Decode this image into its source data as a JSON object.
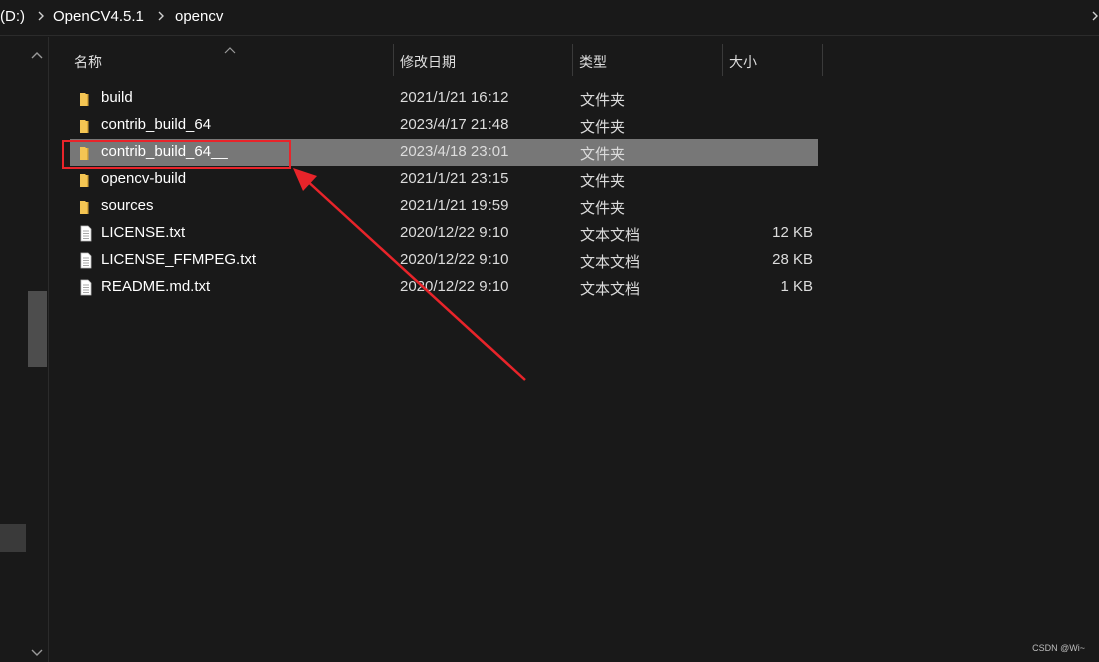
{
  "breadcrumb": {
    "drive": "(D:)",
    "folder1": "OpenCV4.5.1",
    "folder2": "opencv"
  },
  "columns": {
    "name": "名称",
    "date": "修改日期",
    "type": "类型",
    "size": "大小"
  },
  "files": [
    {
      "name": "build",
      "date": "2021/1/21 16:12",
      "type": "文件夹",
      "size": "",
      "icon": "folder-icon"
    },
    {
      "name": "contrib_build_64",
      "date": "2023/4/17 21:48",
      "type": "文件夹",
      "size": "",
      "icon": "folder-icon"
    },
    {
      "name": "contrib_build_64__",
      "date": "2023/4/18 23:01",
      "type": "文件夹",
      "size": "",
      "icon": "folder-icon",
      "selected": true
    },
    {
      "name": "opencv-build",
      "date": "2021/1/21 23:15",
      "type": "文件夹",
      "size": "",
      "icon": "folder-icon"
    },
    {
      "name": "sources",
      "date": "2021/1/21 19:59",
      "type": "文件夹",
      "size": "",
      "icon": "folder-icon"
    },
    {
      "name": "LICENSE.txt",
      "date": "2020/12/22 9:10",
      "type": "文本文档",
      "size": "12 KB",
      "icon": "text-file-icon"
    },
    {
      "name": "LICENSE_FFMPEG.txt",
      "date": "2020/12/22 9:10",
      "type": "文本文档",
      "size": "28 KB",
      "icon": "text-file-icon"
    },
    {
      "name": "README.md.txt",
      "date": "2020/12/22 9:10",
      "type": "文本文档",
      "size": "1 KB",
      "icon": "text-file-icon"
    }
  ],
  "watermark": "CSDN @Wi~",
  "colors": {
    "annotation": "#e8242a",
    "folder": "#f4c553",
    "selected_row": "#777777"
  }
}
